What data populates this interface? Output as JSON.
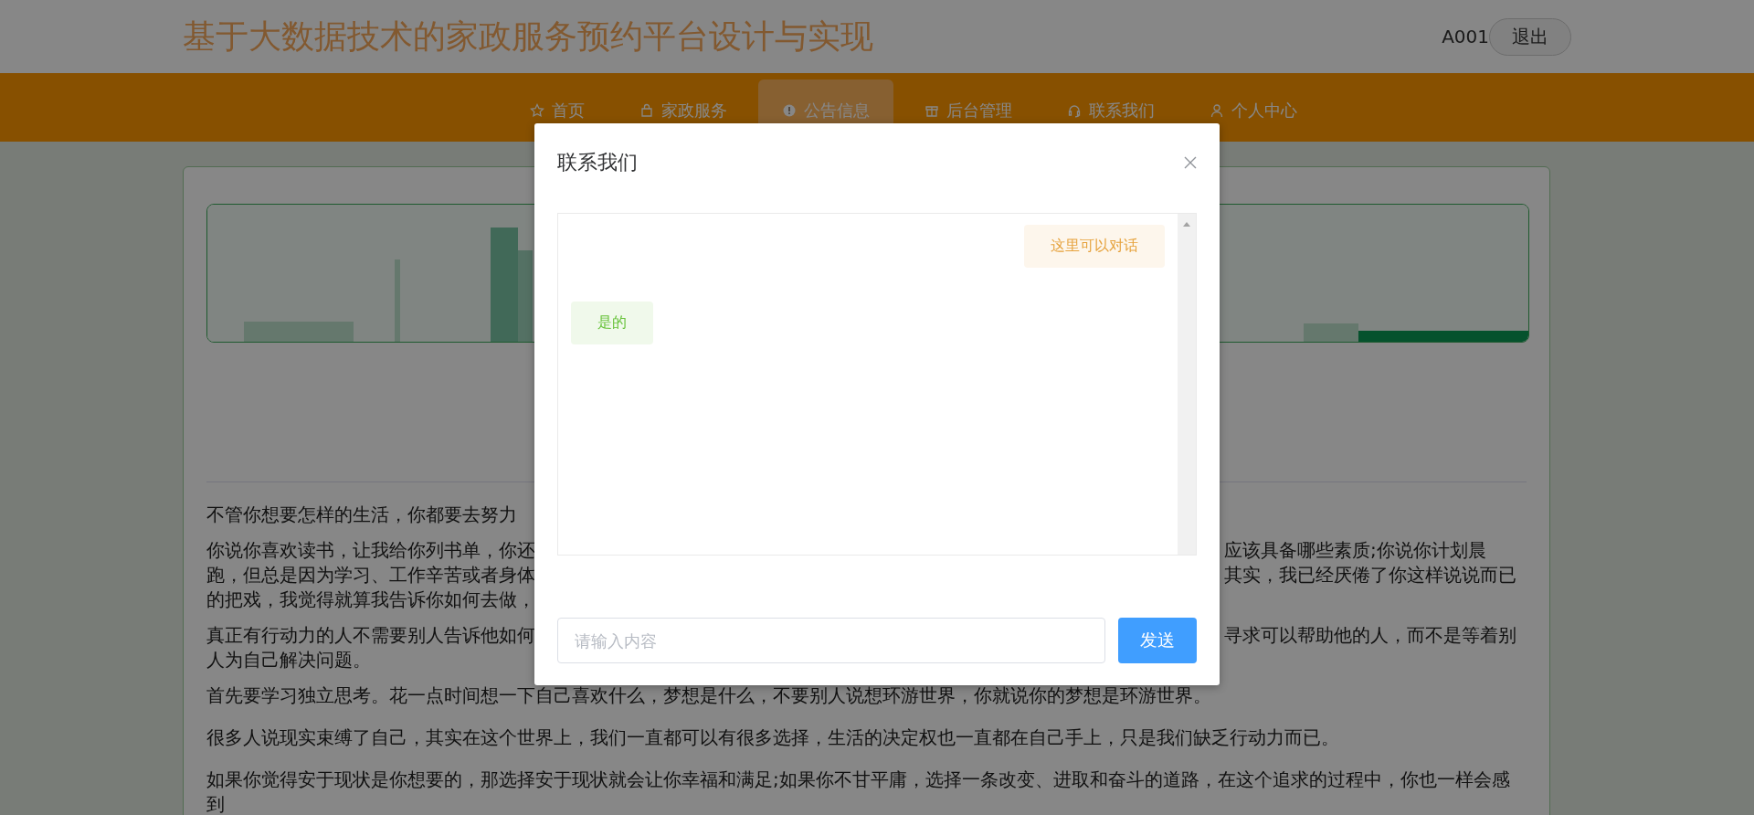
{
  "header": {
    "title": "基于大数据技术的家政服务预约平台设计与实现",
    "user": "A001",
    "logout": "退出"
  },
  "nav": [
    {
      "label": "首页",
      "selected": false
    },
    {
      "label": "家政服务",
      "selected": false
    },
    {
      "label": "公告信息",
      "selected": true
    },
    {
      "label": "后台管理",
      "selected": false
    },
    {
      "label": "联系我们",
      "selected": false
    },
    {
      "label": "个人中心",
      "selected": false
    }
  ],
  "article": {
    "paragraphs": [
      {
        "lines": [
          {
            "left": "不管你想要怎样的生活，你都要去努力"
          }
        ]
      },
      {
        "lines": [
          {
            "left": "你说你喜欢读书，让我给你列书单，你还",
            "right": "应该具备哪些素质;你说你计划晨"
          },
          {
            "left": "跑，但总是因为学习、工作辛苦或者身体",
            "right": "其实，我已经厌倦了你这样说说而已"
          },
          {
            "left": "的把戏，我觉得就算我告诉你如何去做，"
          }
        ]
      },
      {
        "lines": [
          {
            "left": "真正有行动力的人不需要别人告诉他如何",
            "right": "寻求可以帮助他的人，而不是等着别"
          },
          {
            "left": "人为自己解决问题。"
          }
        ]
      },
      {
        "text": "首先要学习独立思考。花一点时间想一下自己喜欢什么，梦想是什么，不要别人说想环游世界，你就说你的梦想是环游世界。"
      },
      {
        "text": "很多人说现实束缚了自己，其实在这个世界上，我们一直都可以有很多选择，生活的决定权也一直都在自己手上，只是我们缺乏行动力而已。"
      },
      {
        "text": "如果你觉得安于现状是你想要的，那选择安于现状就会让你幸福和满足;如果你不甘平庸，选择一条改变、进取和奋斗的道路，在这个追求的过程中，你也一样会感到"
      }
    ]
  },
  "dialog": {
    "title": "联系我们",
    "messages": [
      {
        "kind": "reply",
        "text": "这里可以对话"
      },
      {
        "kind": "user",
        "text": "是的"
      }
    ],
    "input": {
      "placeholder": "请输入内容"
    },
    "send": "发送"
  }
}
